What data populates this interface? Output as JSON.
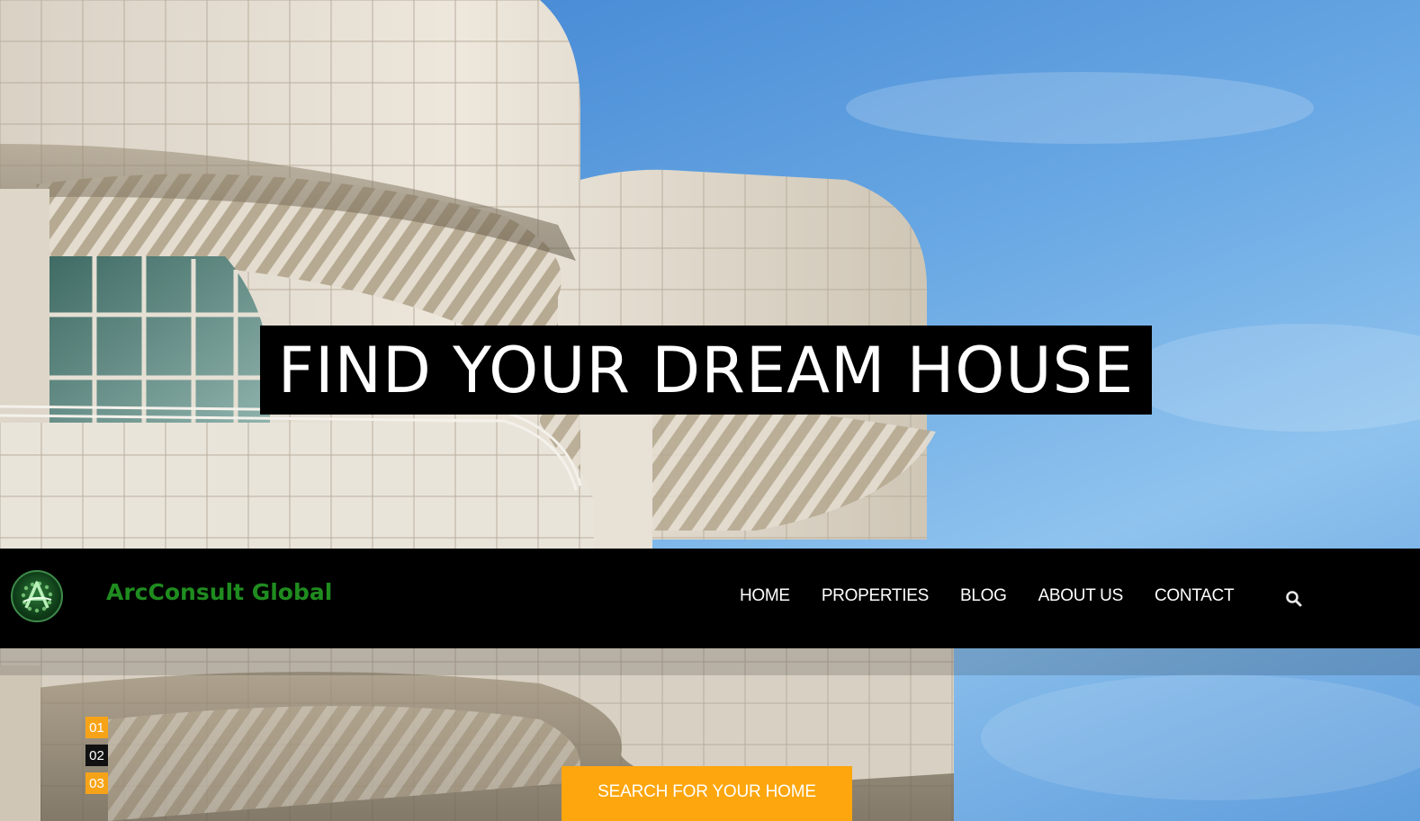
{
  "hero": {
    "headline": "FIND YOUR DREAM HOUSE"
  },
  "header": {
    "logo_icon": "arcconsult-globe-logo",
    "brand_name": "ArcConsult Global",
    "brand_color": "#1f8c1f",
    "nav": [
      {
        "label": "HOME"
      },
      {
        "label": "PROPERTIES"
      },
      {
        "label": "BLOG"
      },
      {
        "label": "ABOUT US"
      },
      {
        "label": "CONTACT"
      }
    ],
    "search_icon": "search-icon"
  },
  "slider": {
    "pages": [
      {
        "label": "01",
        "color": "#f7a318"
      },
      {
        "label": "02",
        "color": "#111111"
      },
      {
        "label": "03",
        "color": "#f7a318"
      }
    ]
  },
  "cta": {
    "label": "SEARCH FOR YOUR HOME",
    "color": "#fda60d"
  },
  "colors": {
    "nav_background": "#000000",
    "sky": "#5a9ad8"
  }
}
